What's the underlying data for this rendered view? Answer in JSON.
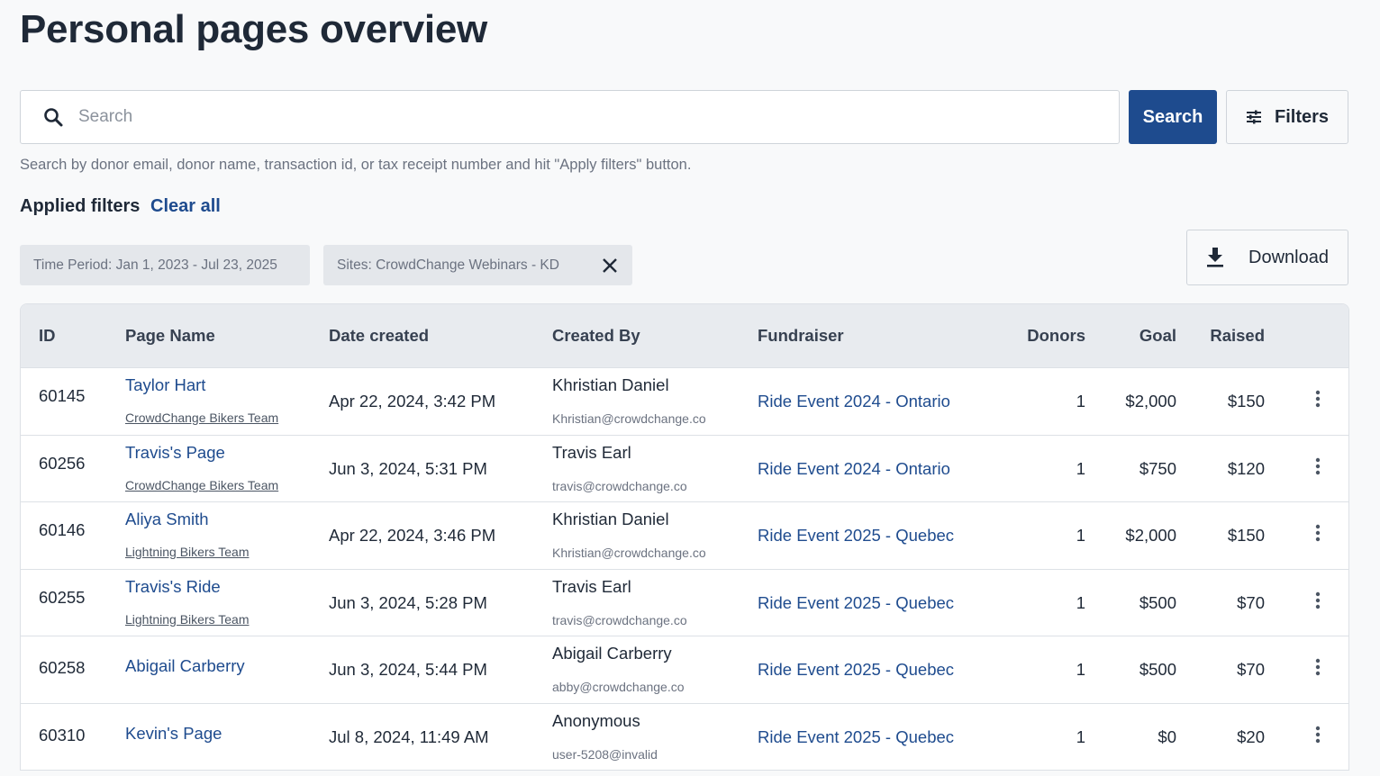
{
  "page": {
    "title": "Personal pages overview"
  },
  "search": {
    "placeholder": "Search",
    "value": "",
    "button_label": "Search",
    "filters_label": "Filters",
    "helper_text": "Search by donor email, donor name, transaction id, or tax receipt number and hit \"Apply filters\" button."
  },
  "filters": {
    "applied_label": "Applied filters",
    "clear_all_label": "Clear all",
    "chips": [
      {
        "label": "Time Period: Jan 1, 2023 - Jul 23, 2025",
        "removable": false
      },
      {
        "label": "Sites: CrowdChange Webinars - KD",
        "removable": true
      }
    ]
  },
  "download": {
    "label": "Download"
  },
  "table": {
    "columns": [
      "ID",
      "Page Name",
      "Date created",
      "Created By",
      "Fundraiser",
      "Donors",
      "Goal",
      "Raised"
    ],
    "rows": [
      {
        "id": "60145",
        "page_name": "Taylor Hart",
        "team": "CrowdChange Bikers Team",
        "date": "Apr 22, 2024, 3:42 PM",
        "creator": "Khristian Daniel",
        "email": "Khristian@crowdchange.co",
        "fundraiser": "Ride Event 2024 - Ontario",
        "donors": "1",
        "goal": "$2,000",
        "raised": "$150"
      },
      {
        "id": "60256",
        "page_name": "Travis's Page",
        "team": "CrowdChange Bikers Team",
        "date": "Jun 3, 2024, 5:31 PM",
        "creator": "Travis Earl",
        "email": "travis@crowdchange.co",
        "fundraiser": "Ride Event 2024 - Ontario",
        "donors": "1",
        "goal": "$750",
        "raised": "$120"
      },
      {
        "id": "60146",
        "page_name": "Aliya Smith",
        "team": "Lightning Bikers Team",
        "date": "Apr 22, 2024, 3:46 PM",
        "creator": "Khristian Daniel",
        "email": "Khristian@crowdchange.co",
        "fundraiser": "Ride Event 2025 - Quebec",
        "donors": "1",
        "goal": "$2,000",
        "raised": "$150"
      },
      {
        "id": "60255",
        "page_name": "Travis's Ride",
        "team": "Lightning Bikers Team",
        "date": "Jun 3, 2024, 5:28 PM",
        "creator": "Travis Earl",
        "email": "travis@crowdchange.co",
        "fundraiser": "Ride Event 2025 - Quebec",
        "donors": "1",
        "goal": "$500",
        "raised": "$70"
      },
      {
        "id": "60258",
        "page_name": "Abigail Carberry",
        "team": "",
        "date": "Jun 3, 2024, 5:44 PM",
        "creator": "Abigail Carberry",
        "email": "abby@crowdchange.co",
        "fundraiser": "Ride Event 2025 - Quebec",
        "donors": "1",
        "goal": "$500",
        "raised": "$70"
      },
      {
        "id": "60310",
        "page_name": "Kevin's Page",
        "team": "",
        "date": "Jul 8, 2024, 11:49 AM",
        "creator": "Anonymous",
        "email": "user-5208@invalid",
        "fundraiser": "Ride Event 2025 - Quebec",
        "donors": "1",
        "goal": "$0",
        "raised": "$20"
      }
    ]
  },
  "icons": {
    "search": "search-icon",
    "filters": "sliders-icon",
    "chip_remove": "close-icon",
    "download": "download-icon",
    "row_menu": "more-vertical-icon"
  },
  "colors": {
    "primary": "#1e4b8e",
    "link": "#1e4b8e",
    "chip_bg": "#e4e7eb",
    "header_bg": "#e8ebef"
  }
}
